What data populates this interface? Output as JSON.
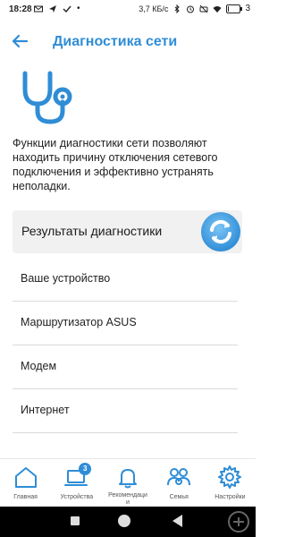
{
  "status_bar": {
    "time": "18:28",
    "net_speed": "3,7 КБ/с",
    "battery": "3"
  },
  "header": {
    "title": "Диагностика сети"
  },
  "description": "Функции диагностики сети позволяют находить причину отключения сетевого подключения и эффективно устранять неполадки.",
  "results": {
    "label": "Результаты диагностики"
  },
  "diagnostic_items": [
    {
      "label": "Ваше устройство"
    },
    {
      "label": "Маршрутизатор ASUS"
    },
    {
      "label": "Модем"
    },
    {
      "label": "Интернет"
    }
  ],
  "bottom_nav": [
    {
      "label": "Главная",
      "icon": "home-icon"
    },
    {
      "label": "Устройства",
      "icon": "devices-icon",
      "badge": "3"
    },
    {
      "label": "Рекомендаци\nи",
      "icon": "bell-icon"
    },
    {
      "label": "Семья",
      "icon": "family-icon"
    },
    {
      "label": "Настройки",
      "icon": "gear-icon"
    }
  ],
  "colors": {
    "accent": "#2f8dd6",
    "card_bg": "#f1f1f1"
  }
}
